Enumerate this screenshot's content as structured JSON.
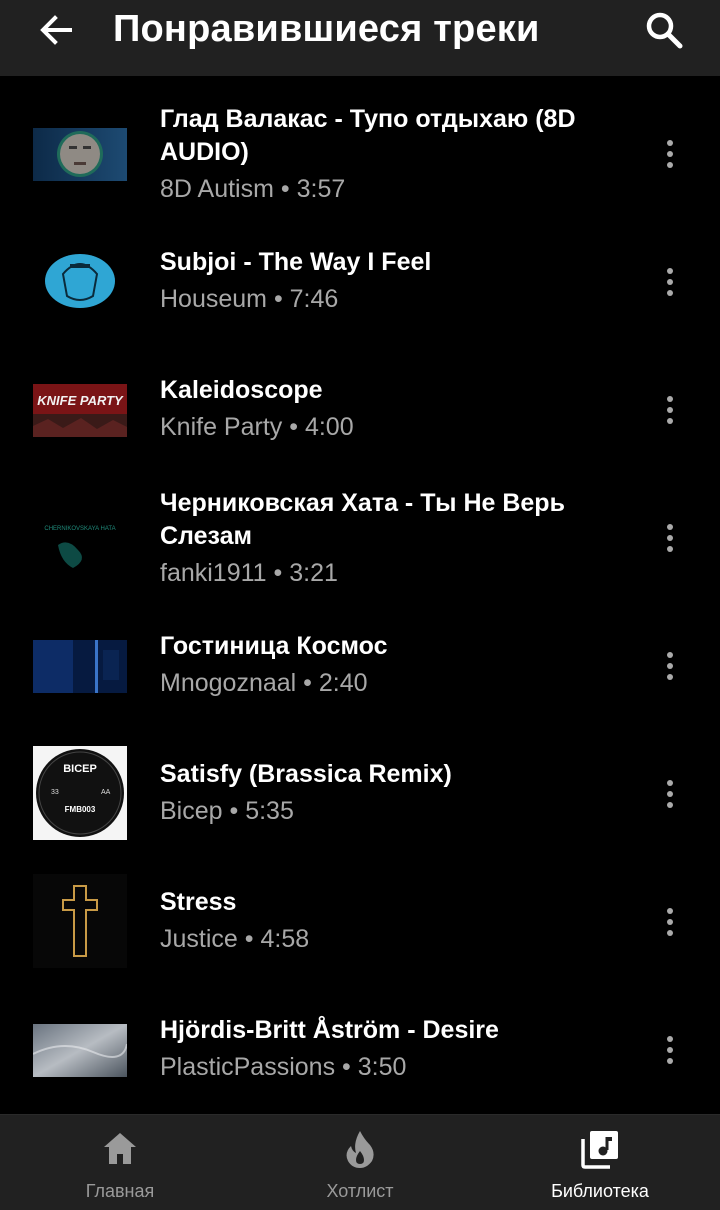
{
  "header": {
    "title": "Понравившиеся треки",
    "back_icon": "arrow-left-icon",
    "search_icon": "search-icon"
  },
  "tracks": [
    {
      "title": "Глад Валакас - Тупо отдыхаю (8D AUDIO)",
      "artist": "8D Autism",
      "duration": "3:57"
    },
    {
      "title": "Subjoi - The Way I Feel",
      "artist": "Houseum",
      "duration": "7:46"
    },
    {
      "title": "Kaleidoscope",
      "artist": "Knife Party",
      "duration": "4:00"
    },
    {
      "title": "Черниковская Хата - Ты Не Верь Слезам",
      "artist": "fanki1911",
      "duration": "3:21"
    },
    {
      "title": "Гостиница Космос",
      "artist": "Mnogoznaal",
      "duration": "2:40"
    },
    {
      "title": "Satisfy (Brassica Remix)",
      "artist": "Bicep",
      "duration": "5:35"
    },
    {
      "title": "Stress",
      "artist": "Justice",
      "duration": "4:58"
    },
    {
      "title": "Hjördis-Britt Åström - Desire",
      "artist": "PlasticPassions",
      "duration": "3:50"
    }
  ],
  "thumb_text": {
    "knife_party": "KNIFE PARTY",
    "chernikovskaya": "CHERNIKOVSKAYA HATA",
    "bicep": "BICEP",
    "bicep_code": "FMB003",
    "bicep_side_a": "33",
    "bicep_side_b": "AA"
  },
  "bottom_nav": [
    {
      "label": "Главная",
      "icon": "home-icon",
      "active": false
    },
    {
      "label": "Хотлист",
      "icon": "fire-icon",
      "active": false
    },
    {
      "label": "Библиотека",
      "icon": "library-music-icon",
      "active": true
    }
  ],
  "colors": {
    "bar_bg": "#212121",
    "bg": "#000000",
    "subtitle": "#a8a8a8",
    "nav_inactive": "#9a9a9a"
  }
}
